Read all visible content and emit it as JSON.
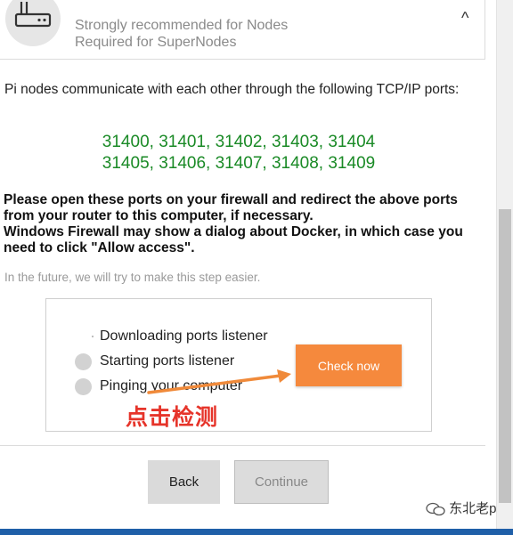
{
  "header": {
    "line1": "Strongly recommended for Nodes",
    "line2": "Required for SuperNodes",
    "caret": "^"
  },
  "intro": "Pi nodes communicate with each other through the following TCP/IP ports:",
  "ports": {
    "row1": "31400, 31401, 31402, 31403, 31404",
    "row2": "31405, 31406, 31407, 31408, 31409"
  },
  "instruction": {
    "line1": "Please open these ports on your firewall and redirect the above ports from your router to this computer, if necessary.",
    "line2": "Windows Firewall may show a dialog about Docker, in which case you need to click \"Allow access\"."
  },
  "future_note": "In the future, we will try to make this step easier.",
  "steps": [
    {
      "label": "Downloading ports listener"
    },
    {
      "label": "Starting ports listener"
    },
    {
      "label": "Pinging your computer"
    }
  ],
  "check_button": "Check now",
  "annotation": "点击检测",
  "buttons": {
    "back": "Back",
    "continue": "Continue"
  },
  "watermark": "东北老p",
  "colors": {
    "accent": "#f5893d",
    "ports": "#1a8a26",
    "annotation": "#e6342a"
  }
}
